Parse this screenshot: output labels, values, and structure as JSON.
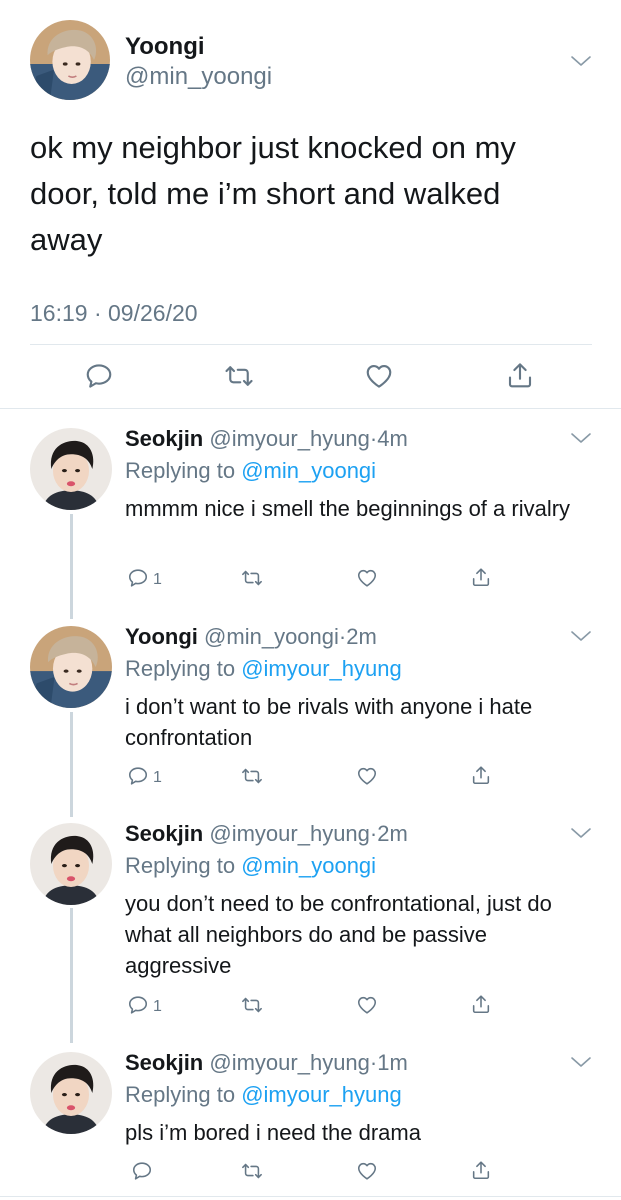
{
  "main_tweet": {
    "name": "Yoongi",
    "handle": "@min_yoongi",
    "text_lines": [
      "ok my neighbor just knocked on my",
      "door, told me i’m short and walked",
      "away"
    ],
    "time": "16:19",
    "date": "09/26/20",
    "actions": [
      "reply-icon",
      "retweet-icon",
      "like-icon",
      "share-icon"
    ]
  },
  "replies": [
    {
      "name": "Seokjin",
      "handle": "@imyour_hyung",
      "time": "4m",
      "replying_label": "Replying to",
      "replying_to": "@min_yoongi",
      "text": "mmmm nice i smell the beginnings of a rivalry",
      "reply_count": "1"
    },
    {
      "name": "Yoongi",
      "handle": "@min_yoongi",
      "time": "2m",
      "replying_label": "Replying to",
      "replying_to": "@imyour_hyung",
      "text": "i don’t want to be rivals with anyone i hate confrontation",
      "reply_count": "1"
    },
    {
      "name": "Seokjin",
      "handle": "@imyour_hyung",
      "time": "2m",
      "replying_label": "Replying to",
      "replying_to": "@min_yoongi",
      "text": "you don’t need to be confrontational, just do what all neighbors do and be passive aggressive",
      "reply_count": "1"
    },
    {
      "name": "Seokjin",
      "handle": "@imyour_hyung",
      "time": "1m",
      "replying_label": "Replying to",
      "replying_to": "@imyour_hyung",
      "text": "pls i’m bored i need the drama",
      "reply_count": ""
    }
  ],
  "colors": {
    "link": "#1da1f2",
    "muted": "#657786",
    "divider": "#e1e8ed",
    "text": "#14171a"
  }
}
